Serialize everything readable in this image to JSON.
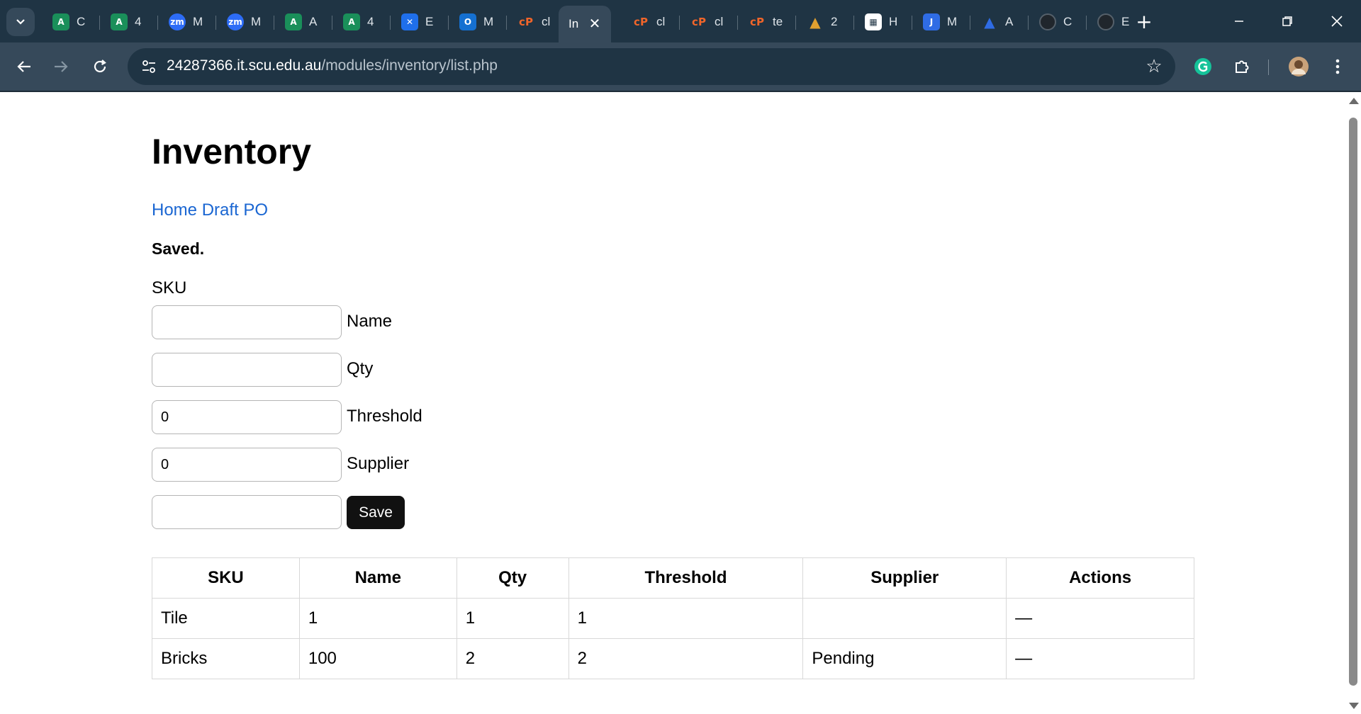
{
  "browser": {
    "tabs": [
      {
        "label": "C",
        "icon": "a-logo-icon",
        "color": "#1a8f5a"
      },
      {
        "label": "4",
        "icon": "a-logo-icon",
        "color": "#1a8f5a"
      },
      {
        "label": "M",
        "icon": "zoom-icon",
        "color": "#2d6cf6"
      },
      {
        "label": "M",
        "icon": "zoom-icon",
        "color": "#2d6cf6"
      },
      {
        "label": "A",
        "icon": "a-logo-icon",
        "color": "#1a8f5a"
      },
      {
        "label": "4",
        "icon": "a-logo-icon",
        "color": "#1a8f5a"
      },
      {
        "label": "E",
        "icon": "confluence-icon",
        "color": "#1f6feb"
      },
      {
        "label": "M",
        "icon": "outlook-icon",
        "color": "#1570d1"
      },
      {
        "label": "cl",
        "icon": "cpanel-icon",
        "color": "#f0652a"
      },
      {
        "label": "In",
        "icon": "",
        "color": "",
        "active": true
      },
      {
        "label": "cl",
        "icon": "cpanel-icon",
        "color": "#f0652a"
      },
      {
        "label": "cl",
        "icon": "cpanel-icon",
        "color": "#f0652a"
      },
      {
        "label": "te",
        "icon": "cpanel-icon",
        "color": "#f0652a"
      },
      {
        "label": "2",
        "icon": "scu-logo-icon",
        "color": "#e0a030"
      },
      {
        "label": "H",
        "icon": "apps-icon",
        "color": "#ffffff"
      },
      {
        "label": "M",
        "icon": "jira-icon",
        "color": "#2f6ce5"
      },
      {
        "label": "A",
        "icon": "atlassian-icon",
        "color": "#2f6ce5"
      },
      {
        "label": "C",
        "icon": "github-icon",
        "color": "#20262c"
      },
      {
        "label": "E",
        "icon": "github-icon",
        "color": "#20262c"
      }
    ],
    "url_host": "24287366.it.scu.edu.au",
    "url_path": "/modules/inventory/list.php"
  },
  "page": {
    "title": "Inventory",
    "nav": {
      "home": "Home",
      "draft_po": "Draft PO"
    },
    "status": "Saved."
  },
  "form": {
    "labels": {
      "sku": "SKU",
      "name": "Name",
      "qty": "Qty",
      "threshold": "Threshold",
      "supplier": "Supplier"
    },
    "values": {
      "sku": "",
      "name": "",
      "qty": "0",
      "threshold": "0",
      "supplier": ""
    },
    "save_label": "Save"
  },
  "table": {
    "headers": [
      "SKU",
      "Name",
      "Qty",
      "Threshold",
      "Supplier",
      "Actions"
    ],
    "rows": [
      [
        "Tile",
        "1",
        "1",
        "1",
        "",
        "—"
      ],
      [
        "Bricks",
        "100",
        "2",
        "2",
        "Pending",
        "—"
      ]
    ]
  }
}
